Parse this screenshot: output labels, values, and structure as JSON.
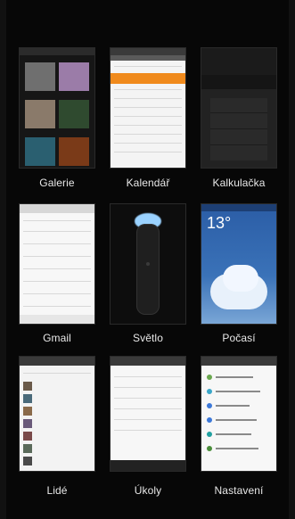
{
  "apps": [
    {
      "id": "galerie",
      "label": "Galerie"
    },
    {
      "id": "kalendar",
      "label": "Kalendář"
    },
    {
      "id": "kalkulacka",
      "label": "Kalkulačka"
    },
    {
      "id": "gmail",
      "label": "Gmail"
    },
    {
      "id": "svetlo",
      "label": "Světlo"
    },
    {
      "id": "pocasi",
      "label": "Počasí"
    },
    {
      "id": "lide",
      "label": "Lidé"
    },
    {
      "id": "ukoly",
      "label": "Úkoly"
    },
    {
      "id": "nastaveni",
      "label": "Nastavení"
    }
  ],
  "weather": {
    "temperature": "13°"
  },
  "colors": {
    "background": "#070707",
    "calendar_accent": "#f08a1c",
    "weather_sky": "#3a72b8"
  }
}
